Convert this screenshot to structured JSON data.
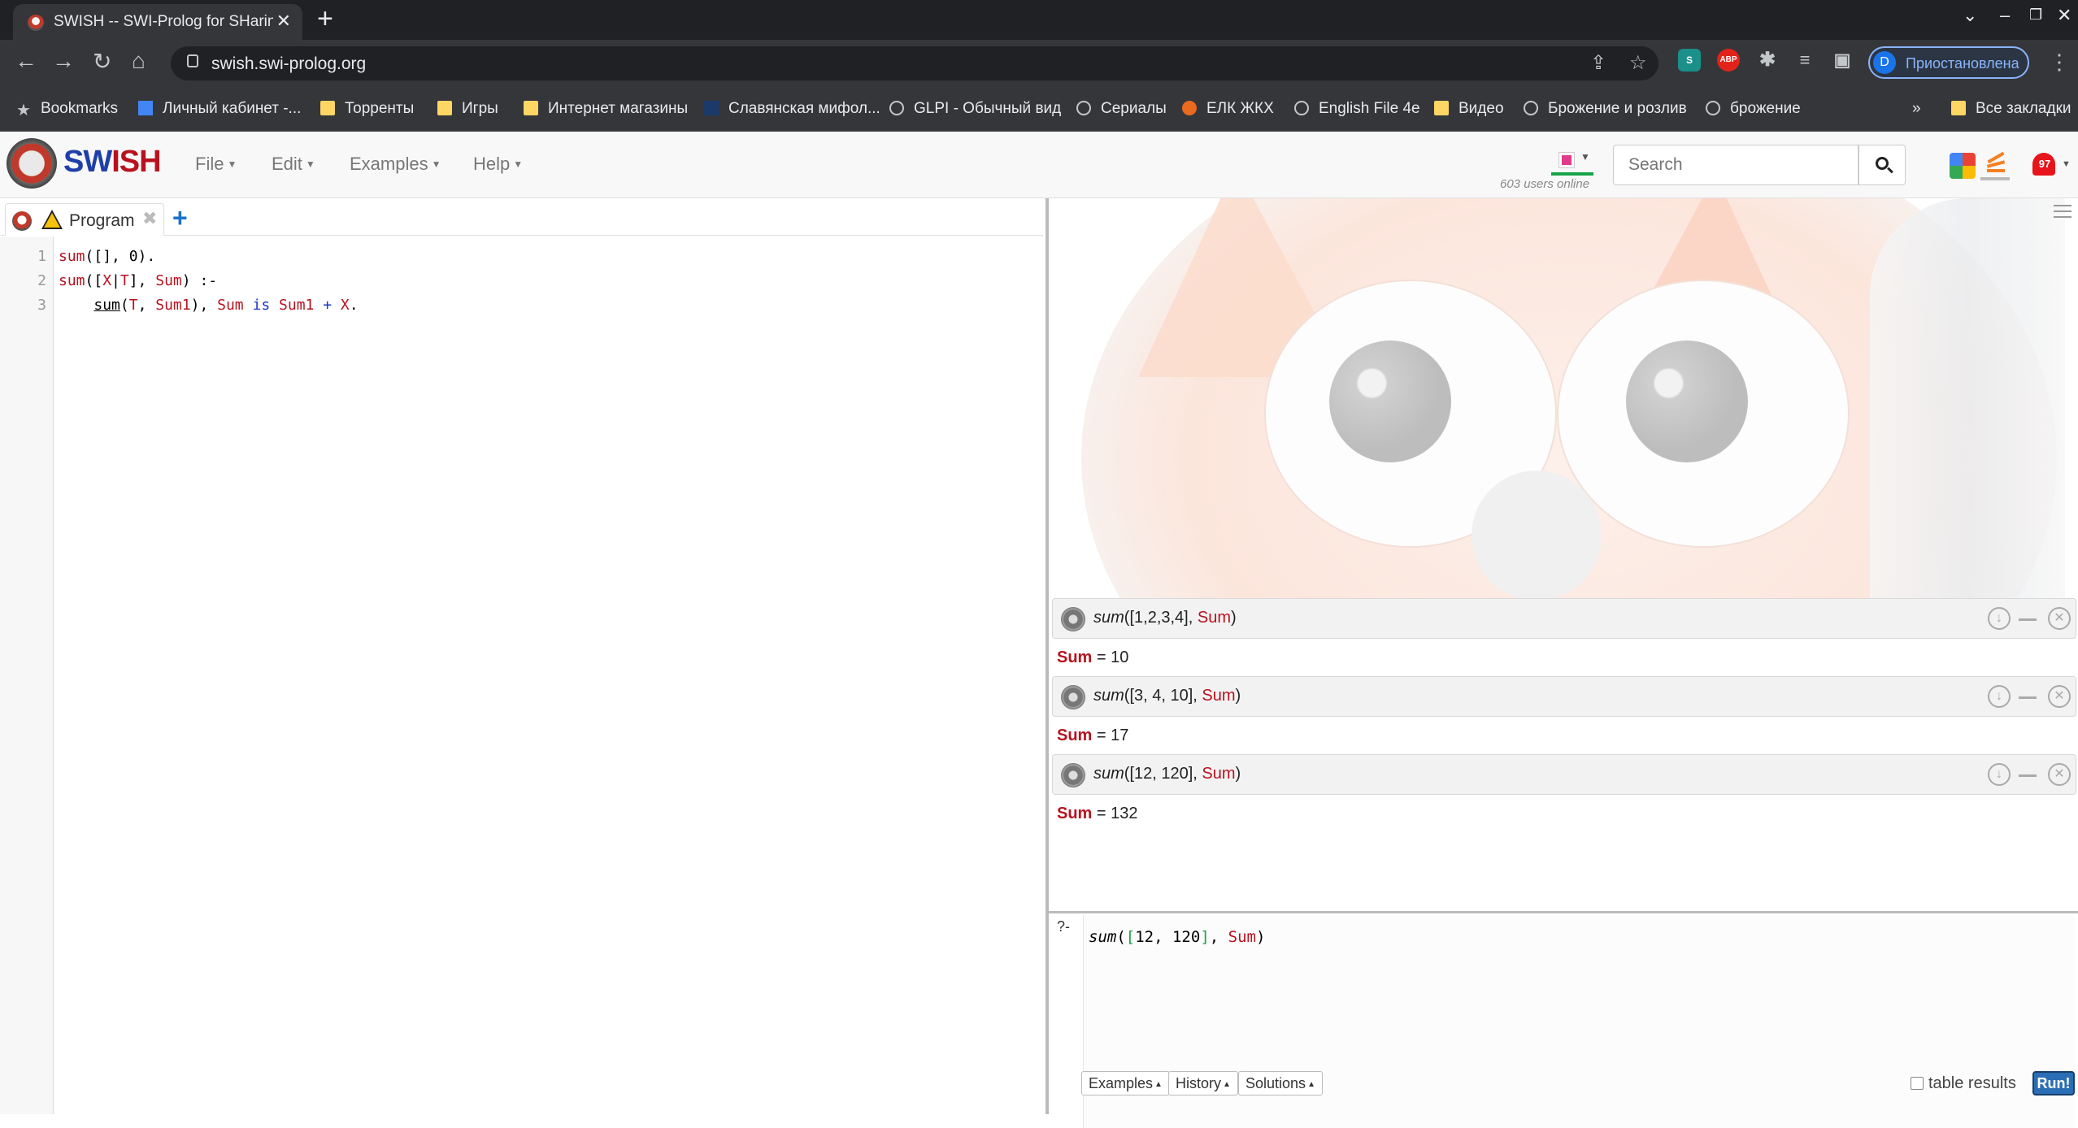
{
  "browser": {
    "tab_title": "SWISH -- SWI-Prolog for SHaring",
    "url": "swish.swi-prolog.org",
    "profile_letter": "D",
    "profile_label": "Приостановлена",
    "bookmarks": [
      {
        "label": "Bookmarks",
        "icon": "star-icon"
      },
      {
        "label": "Личный кабинет -...",
        "icon": "site-icon"
      },
      {
        "label": "Торренты",
        "icon": "folder-icon"
      },
      {
        "label": "Игры",
        "icon": "folder-icon"
      },
      {
        "label": "Интернет магазины",
        "icon": "folder-icon"
      },
      {
        "label": "Славянская мифол...",
        "icon": "site-icon"
      },
      {
        "label": "GLPI - Обычный вид",
        "icon": "globe-icon"
      },
      {
        "label": "Сериалы",
        "icon": "globe-icon"
      },
      {
        "label": "ЕЛК ЖКХ",
        "icon": "site-icon"
      },
      {
        "label": "English File 4e",
        "icon": "globe-icon"
      },
      {
        "label": "Видео",
        "icon": "folder-icon"
      },
      {
        "label": "Брожение и розлив",
        "icon": "globe-icon"
      },
      {
        "label": "брожение",
        "icon": "globe-icon"
      }
    ],
    "bookmarks_overflow": "»",
    "all_bookmarks": "Все закладки",
    "ext_abp": "ABP"
  },
  "swish": {
    "logo_sw": "SW",
    "logo_ish": "ISH",
    "menus": [
      "File",
      "Edit",
      "Examples",
      "Help"
    ],
    "users_online": "603 users online",
    "search_placeholder": "Search",
    "notification_count": "97"
  },
  "editor": {
    "tab_label": "Program",
    "line_numbers": [
      "1",
      "2",
      "3"
    ]
  },
  "queries": [
    {
      "fn": "sum",
      "args": "([1,2,3,4], ",
      "var": "Sum",
      "close": ")",
      "answer_var": "Sum",
      "answer_val": " = 10"
    },
    {
      "fn": "sum",
      "args": "([3, 4, 10], ",
      "var": "Sum",
      "close": ")",
      "answer_var": "Sum",
      "answer_val": " = 17"
    },
    {
      "fn": "sum",
      "args": "([12, 120], ",
      "var": "Sum",
      "close": ")",
      "answer_var": "Sum",
      "answer_val": " = 132"
    }
  ],
  "query_editor": {
    "prompt": "?-",
    "buttons": [
      "Examples",
      "History",
      "Solutions"
    ],
    "table_results": "table results",
    "run": "Run!"
  },
  "colors": {
    "swish_blue": "#1f3fa8",
    "swish_red": "#b8121f",
    "run_button": "#2a6eb5"
  }
}
